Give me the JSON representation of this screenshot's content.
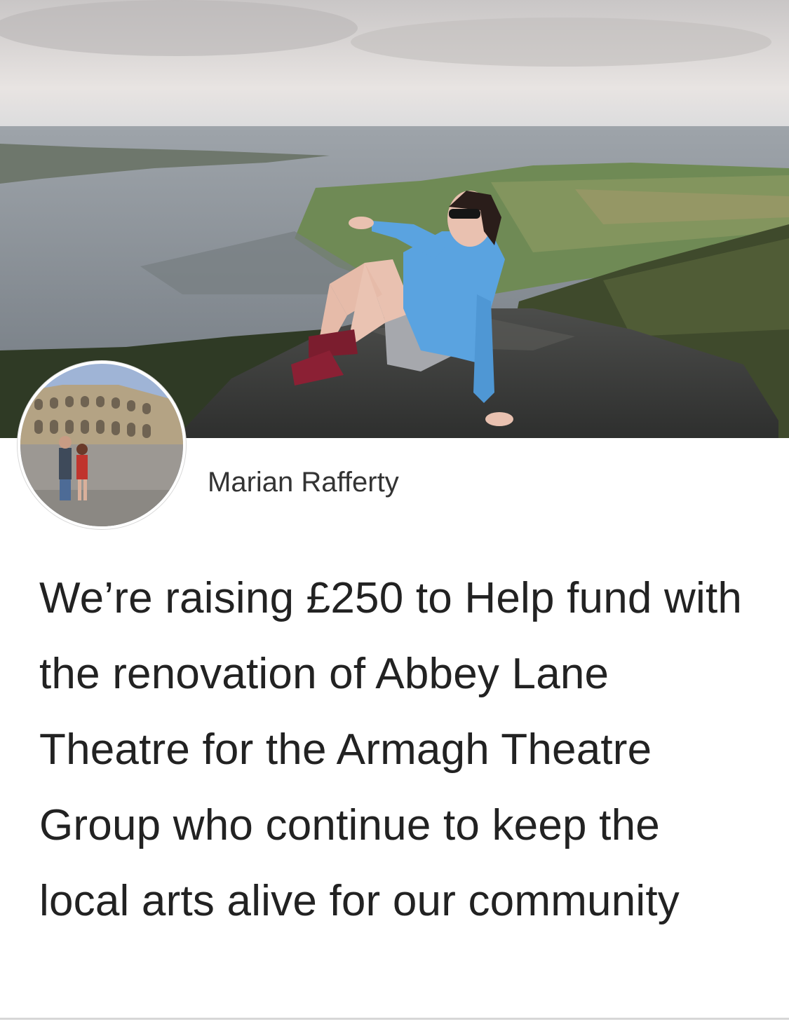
{
  "cover_photo": {
    "icon": "landscape-photo"
  },
  "creator": {
    "avatar_icon": "avatar-photo",
    "name": "Marian Rafferty"
  },
  "fundraiser": {
    "title": "We’re raising £250 to Help fund with the renovation of Abbey Lane Theatre for the Armagh Theatre Group who continue to keep the local arts alive for our community"
  },
  "colors": {
    "sky": "#d9d6d4",
    "sea": "#8a9096",
    "hoodie": "#5aa3e0",
    "text": "#222222"
  }
}
